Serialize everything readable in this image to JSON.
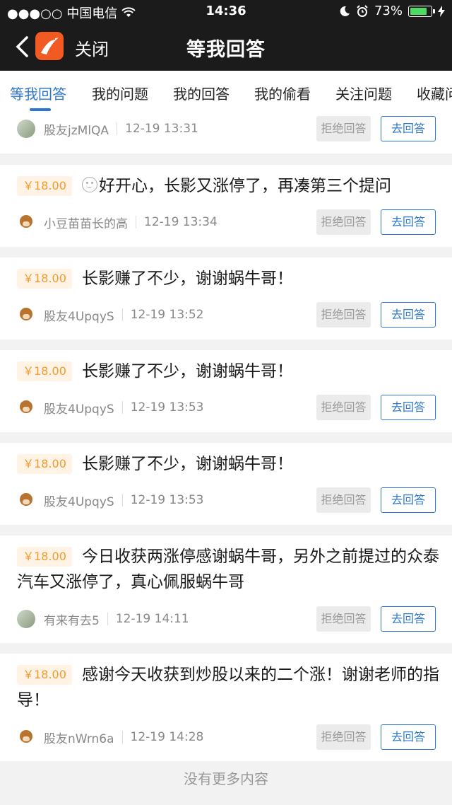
{
  "status_bar": {
    "carrier": "●●●○○ 中国电信",
    "time": "14:36",
    "battery": "73%"
  },
  "nav": {
    "close_label": "关闭",
    "title": "等我回答"
  },
  "tabs": [
    "等我回答",
    "我的问题",
    "我的回答",
    "我的偷看",
    "关注问题",
    "收藏问"
  ],
  "buttons": {
    "reject": "拒绝回答",
    "answer": "去回答"
  },
  "partial_item": {
    "user": "股友jzMlQA",
    "time": "12-19 13:31"
  },
  "items": [
    {
      "price": "￥18.00",
      "text": "好开心，长影又涨停了，再凑第三个提问",
      "user": "小豆苗苗长的高",
      "time": "12-19 13:34"
    },
    {
      "price": "￥18.00",
      "text": "长影赚了不少，谢谢蜗牛哥！",
      "user": "股友4UpqyS",
      "time": "12-19 13:52"
    },
    {
      "price": "￥18.00",
      "text": "长影赚了不少，谢谢蜗牛哥！",
      "user": "股友4UpqyS",
      "time": "12-19 13:53"
    },
    {
      "price": "￥18.00",
      "text": "长影赚了不少，谢谢蜗牛哥！",
      "user": "股友4UpqyS",
      "time": "12-19 13:53"
    },
    {
      "price": "￥18.00",
      "text": "今日收获两涨停感谢蜗牛哥，另外之前提过的众泰汽车又涨停了，真心佩服蜗牛哥",
      "user": "有来有去5",
      "time": "12-19 14:11"
    },
    {
      "price": "￥18.00",
      "text": "感谢今天收获到炒股以来的二个涨！谢谢老师的指导！",
      "user": "股友nWrn6a",
      "time": "12-19 14:28"
    }
  ],
  "footer": "没有更多内容"
}
